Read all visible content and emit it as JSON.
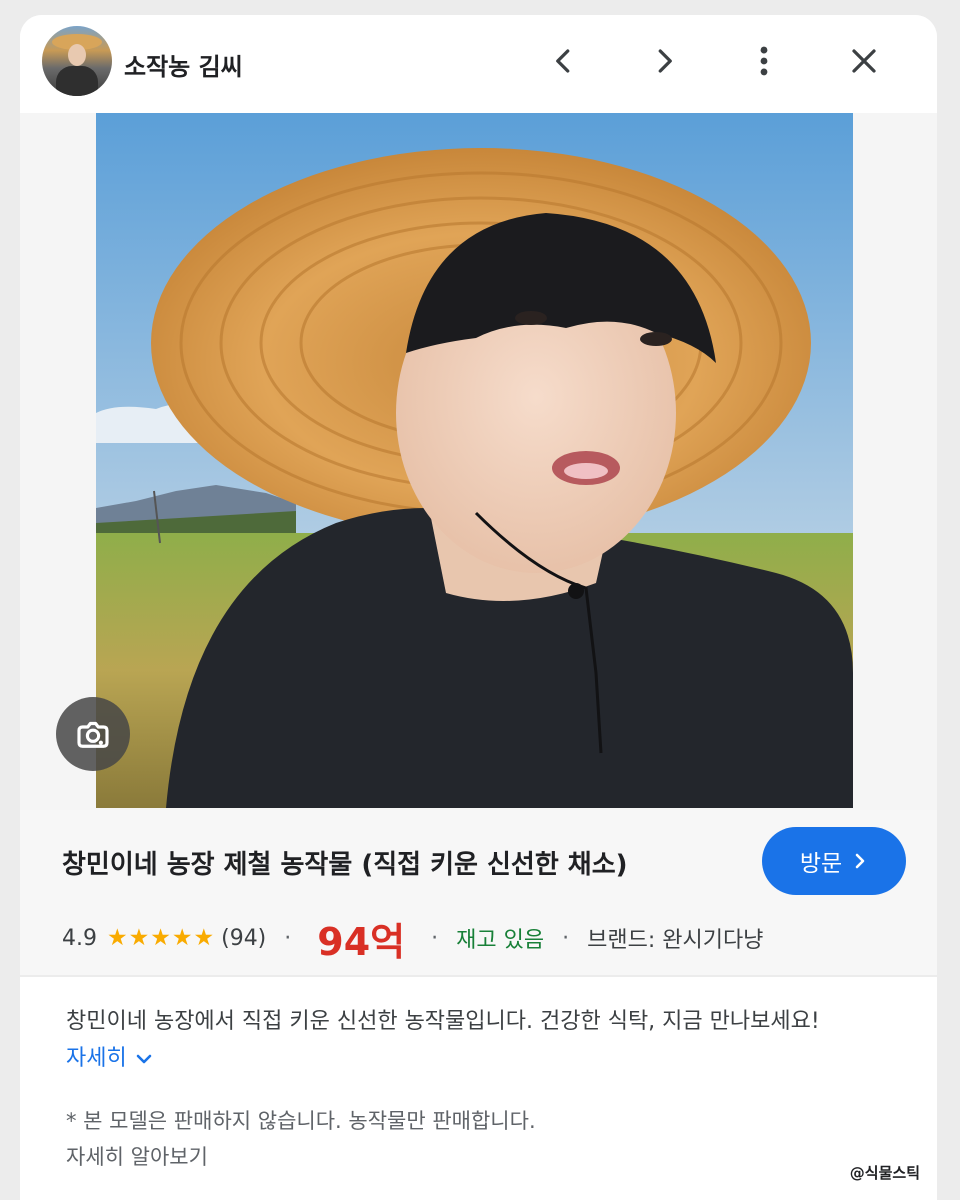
{
  "header": {
    "channel_name": "소작농 김씨",
    "icons": [
      "back-icon",
      "forward-icon",
      "more-vert-icon",
      "close-icon"
    ]
  },
  "image": {
    "lens_icon": "lens-search-icon"
  },
  "product": {
    "title": "창민이네 농장 제철 농작물 (직접 키운 신선한 채소)",
    "visit_label": "방문",
    "rating": "4.9",
    "stars": "★★★★★",
    "review_count": "(94)",
    "price": "94억",
    "stock": "재고 있음",
    "brand": "브랜드: 완시기다냥",
    "separator": "·"
  },
  "description": {
    "text": "창민이네 농장에서 직접 키운 신선한 농작물입니다. 건강한 식탁, 지금 만나보세요!",
    "more_label": "자세히"
  },
  "note": {
    "line1": "* 본 모델은 판매하지 않습니다. 농작물만 판매합니다.",
    "line2": "자세히 알아보기"
  },
  "watermark": "@식물스틱",
  "colors": {
    "accent": "#1a73e8",
    "price": "#d93025",
    "stock": "#188038",
    "stars": "#f9ab00"
  }
}
